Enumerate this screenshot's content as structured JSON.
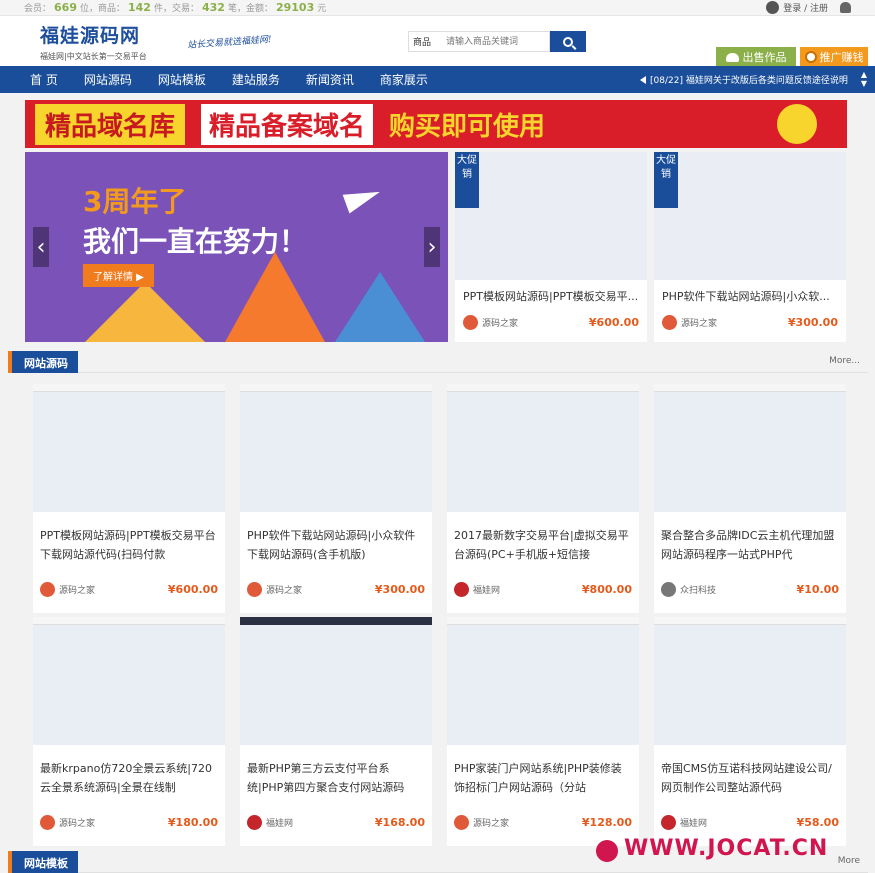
{
  "topbar": {
    "members_label": "会员：",
    "members_count": "669",
    "members_unit": "位，商品：",
    "goods_count": "142",
    "goods_unit": "件，交易：",
    "trades_count": "432",
    "trades_unit": "笔，金额：",
    "amount": "29103",
    "amount_unit": "元",
    "login": "登录 / 注册"
  },
  "header": {
    "logo": "福娃源码网",
    "logo_sub": "福娃网|中文站长第一交易平台",
    "slogan": "站长交易就选福娃网!",
    "search_type": "商品",
    "search_placeholder": "请输入商品关键词",
    "sell_button": "出售作品",
    "promo_button": "推广赚钱"
  },
  "nav": {
    "items": [
      "首 页",
      "网站源码",
      "网站模板",
      "建站服务",
      "新闻资讯",
      "商家展示"
    ],
    "notice": "[08/22] 福娃网关于改版后各类问题反馈途径说明"
  },
  "banner": {
    "part1": "精品域名库",
    "part2": "精品备案域名",
    "part3": "购买即可使用"
  },
  "slider": {
    "line1": "3周年了",
    "line2": "我们一直在努力！",
    "cta": "了解详情 ▶",
    "prev": "‹",
    "next": "›"
  },
  "featured": [
    {
      "tag": "大促销",
      "title": "PPT模板网站源码|PPT模板交易平...",
      "seller": "源码之家",
      "price": "¥600.00"
    },
    {
      "tag": "大促销",
      "title": "PHP软件下载站网站源码|小众软...",
      "seller": "源码之家",
      "price": "¥300.00"
    }
  ],
  "section1": {
    "title": "网站源码",
    "more": "More...",
    "cards": [
      {
        "title": "PPT模板网站源码|PPT模板交易平台下载网站源代码(扫码付款",
        "seller": "源码之家",
        "price": "¥600.00"
      },
      {
        "title": "PHP软件下载站网站源码|小众软件下载网站源码(含手机版)",
        "seller": "源码之家",
        "price": "¥300.00"
      },
      {
        "title": "2017最新数字交易平台|虚拟交易平台源码(PC+手机版+短信接",
        "seller": "福娃网",
        "price": "¥800.00"
      },
      {
        "title": "聚合整合多品牌IDC云主机代理加盟网站源码程序一站式PHP代",
        "seller": "众扫科技",
        "price": "¥10.00"
      },
      {
        "title": "最新krpano仿720全景云系统|720云全景系统源码|全景在线制",
        "seller": "源码之家",
        "price": "¥180.00"
      },
      {
        "title": "最新PHP第三方云支付平台系统|PHP第四方聚合支付网站源码",
        "seller": "福娃网",
        "price": "¥168.00"
      },
      {
        "title": "PHP家装门户网站系统|PHP装修装饰招标门户网站源码（分站",
        "seller": "源码之家",
        "price": "¥128.00"
      },
      {
        "title": "帝国CMS仿互诺科技网站建设公司/网页制作公司整站源代码",
        "seller": "福娃网",
        "price": "¥58.00"
      }
    ]
  },
  "section2": {
    "title": "网站模板",
    "more": "More"
  },
  "watermark": "WWW.JOCAT.CN",
  "colors": {
    "primary": "#1a4e9a",
    "accent": "#f07c1e",
    "green": "#8bb04a",
    "price": "#e55a1c"
  }
}
